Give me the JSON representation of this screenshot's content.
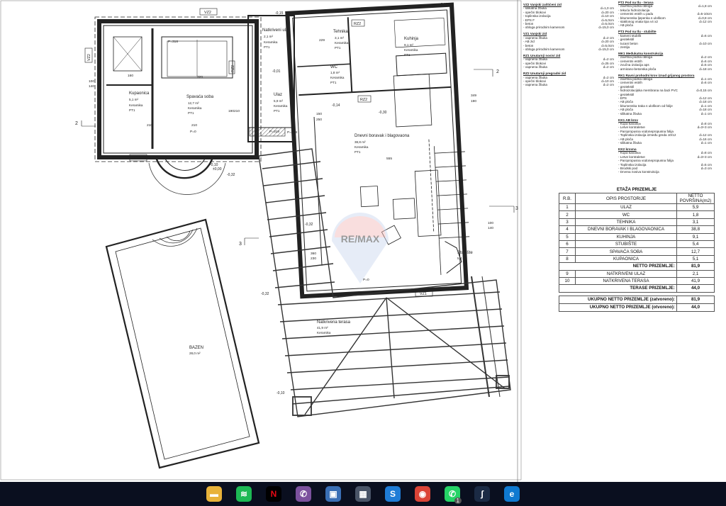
{
  "plan": {
    "rooms": [
      {
        "name": "Natkriveni ulaz",
        "area": "2,1 m²",
        "floor": "Keramika",
        "pt": "PT1"
      },
      {
        "name": "Tehnika",
        "area": "3,1 m²",
        "floor": "Keramika",
        "pt": "PT1"
      },
      {
        "name": "Kuhinja",
        "area": "9,1 m²",
        "floor": "Keramika",
        "pt": "PT1"
      },
      {
        "name": "WC",
        "area": "1,8 m²",
        "floor": "Keramika",
        "pt": "PT1"
      },
      {
        "name": "Spavaća soba",
        "area": "12,7 m²",
        "floor": "Keramika",
        "pt": "PT1"
      },
      {
        "name": "Kupaonica",
        "area": "5,1 m²",
        "floor": "Keramika",
        "pt": "PT1"
      },
      {
        "name": "Ulaz",
        "area": "5,9 m²",
        "floor": "Keramika",
        "pt": "PT1"
      },
      {
        "name": "Dnevni boravak i blagovaona",
        "area": "38,8 m²",
        "floor": "Keramika",
        "pt": "PT1"
      },
      {
        "name": "Stubište",
        "area": "5,4 m²",
        "floor": "",
        "pt": ""
      },
      {
        "name": "Natkrivena terasa",
        "area": "41,9 m²",
        "floor": "Keramika",
        "pt": ""
      },
      {
        "name": "BAZEN",
        "area": "28,0 m²",
        "floor": "",
        "pt": ""
      }
    ],
    "wall_tags": [
      "VZ2",
      "VZ2",
      "VZ2",
      "VZ1",
      "RZ2",
      "RZ2",
      "RZ2"
    ],
    "section_marks": [
      "2",
      "2",
      "3",
      "3"
    ],
    "levels": [
      "-0,15",
      "-0,01",
      "±0,00",
      "-0,30",
      "-0,14",
      "-0,32",
      "-0,10",
      "-0,10",
      "-0,32",
      "-0,32",
      "-0,15"
    ],
    "dimensions": [
      "320",
      "229",
      "160",
      "210",
      "210",
      "210",
      "150",
      "250",
      "555",
      "349",
      "190",
      "100",
      "140",
      "100",
      "140",
      "360",
      "230",
      "190",
      "P=318",
      "P=318",
      "P=318",
      "P=0",
      "P=0"
    ],
    "watermark": "RE/MAX"
  },
  "legend": [
    {
      "title": "VZ2 Vanjski zaštićeni zid",
      "items": [
        [
          "- silikatna žbuka",
          "d=1,0 cm"
        ],
        [
          "- opečni blokovi",
          "d=20 cm"
        ],
        [
          "- toplinska izolacija",
          "d=10 cm"
        ],
        [
          "- EPS F",
          "d=5,0cm"
        ],
        [
          "- beton",
          "d=5,0cm"
        ],
        [
          "- obloga prirodnim kamenom",
          "d=15,0 cm"
        ]
      ]
    },
    {
      "title": "VZ1 Vanjski zid",
      "items": [
        [
          "- vapnena žbuka",
          "d=2 cm"
        ],
        [
          "- AB zid",
          "d=20 cm"
        ],
        [
          "- beton",
          "d=5,0cm"
        ],
        [
          "- obloga prirodnim kamenom",
          "d=15,0 cm"
        ]
      ]
    },
    {
      "title": "RZ1 Unutarnji nosivi zid",
      "items": [
        [
          "- vapnena žbuka",
          "d=2 cm"
        ],
        [
          "- opečni blokovi",
          "d=25 cm"
        ],
        [
          "- vapnena žbuka",
          "d=2 cm"
        ]
      ]
    },
    {
      "title": "RZ2 Unutarnji pregradni zid",
      "items": [
        [
          "- vapnena žbuka",
          "d=2 cm"
        ],
        [
          "- opečni blokovi",
          "d=10 cm"
        ],
        [
          "- vapnena žbuka",
          "d=2 cm"
        ]
      ]
    }
  ],
  "legend2": [
    {
      "title": "PT2 Pod na tlu - terasa",
      "items": [
        [
          "- završna podna obloga",
          "d=1,8 cm"
        ],
        [
          "- tekuća hidroizolacija",
          ""
        ],
        [
          "- cementni estrih u padu",
          "d=5-10cm"
        ],
        [
          "- bitumenska ljepenka s uloškom",
          "d=0,8 cm"
        ],
        [
          "- staklonog vnata tipa v4 x2",
          "d=12 cm"
        ],
        [
          "- AB ploča",
          ""
        ]
      ]
    },
    {
      "title": "PT3 Pod na tlu - stubište",
      "items": [
        [
          "- kameni stubišt",
          "d=6 cm"
        ],
        [
          "- geotekstil",
          ""
        ],
        [
          "- tucani beton",
          "d=10 cm"
        ],
        [
          "- zemlja",
          ""
        ]
      ]
    },
    {
      "title": "MK1 Međukatna konstrukcija",
      "items": [
        [
          "- završna podna obloga",
          "d=2 cm"
        ],
        [
          "- cementni estrih",
          "d=6 cm"
        ],
        [
          "- zvučna izolacija aps",
          "d=5 cm"
        ],
        [
          "- armirano-betonska ploča",
          "d=18 cm"
        ]
      ]
    },
    {
      "title": "RK1 Ravni prohodni krov iznad grijanog prostora",
      "items": [
        [
          "- završna podna obloga",
          "d=1 cm"
        ],
        [
          "- cementni estrih",
          "d=6 cm"
        ],
        [
          "- geotekstil",
          ""
        ],
        [
          "- hidroizolacijska membrana na bazi PVC",
          "d=0,15 cm"
        ],
        [
          "- geotekstil",
          ""
        ],
        [
          "- EPS",
          "d=12 cm"
        ],
        [
          "- AB ploča",
          "d=18 cm"
        ],
        [
          "- bitumenska traka s uloškom od folije",
          "d=1 cm"
        ],
        [
          "- AB ploča",
          "d=18 cm"
        ],
        [
          "- silikatna žbuka",
          "d=1 cm"
        ]
      ]
    },
    {
      "title": "KK1 AB krov",
      "items": [
        [
          "- Kupa kanalica",
          "d=8 cm"
        ],
        [
          "- Letve kontraletve",
          "d=3+3 cm"
        ],
        [
          "- Paropropusna vodonepropusna folija",
          ""
        ],
        [
          "- Toplinska izolacija između greda 10/12",
          "d=12 cm"
        ],
        [
          "- AB ploča",
          "d=16 cm"
        ],
        [
          "- silikatna žbuka",
          "d=1 cm"
        ]
      ]
    },
    {
      "title": "KK2 krovna",
      "items": [
        [
          "- Kupa kanalica",
          "d=8 cm"
        ],
        [
          "- Letve kontraletve",
          "d=3+3 cm"
        ],
        [
          "- Paropropusna vodonepropusna folija",
          ""
        ],
        [
          "- Toplinska izolacija",
          "d=5 cm"
        ],
        [
          "- Brodski pod",
          "d=3 cm"
        ],
        [
          "- Drvena nosiva konstrukcija",
          ""
        ]
      ]
    }
  ],
  "table": {
    "title": "ETAŽA PRIZEMLJE",
    "headers": {
      "rb": "R.B.",
      "desc": "OPIS PROSTORIJE",
      "area": "NETTO POVRŠINA(m2)"
    },
    "rows": [
      {
        "rb": "1",
        "desc": "ULAZ",
        "area": "5,9"
      },
      {
        "rb": "2",
        "desc": "WC",
        "area": "1,8"
      },
      {
        "rb": "3",
        "desc": "TEHNIKA",
        "area": "3,1"
      },
      {
        "rb": "4",
        "desc": "DNEVNI BORAVAK I BLAGOVAONICA",
        "area": "38,8"
      },
      {
        "rb": "5",
        "desc": "KUHINJA",
        "area": "9,1"
      },
      {
        "rb": "6",
        "desc": "STUBIŠTE",
        "area": "5,4"
      },
      {
        "rb": "7",
        "desc": "SPAVAĆA SOBA",
        "area": "12,7"
      },
      {
        "rb": "8",
        "desc": "KUPAONICA",
        "area": "5,1"
      }
    ],
    "net_label": "NETTO PRIZEMLJE:",
    "net_value": "81,9",
    "rows2": [
      {
        "rb": "9",
        "desc": "NATKRIVENI ULAZ",
        "area": "2,1"
      },
      {
        "rb": "10",
        "desc": "NATKRIVENA TERASA",
        "area": "41,9"
      }
    ],
    "terrace_label": "TERASE PRIZEMLJE:",
    "terrace_value": "44,0",
    "total_closed_label": "UKUPNO NETTO PRIZEMLJE (zatvoreno):",
    "total_closed_value": "81,9",
    "total_open_label": "UKUPNO NETTO PRIZEMLJE (otvoreno):",
    "total_open_value": "44,0"
  },
  "taskbar": {
    "apps": [
      {
        "name": "file-explorer-icon",
        "glyph": "▬",
        "color": "#e8b23a"
      },
      {
        "name": "spotify-icon",
        "glyph": "≋",
        "color": "#1db954"
      },
      {
        "name": "netflix-icon",
        "glyph": "N",
        "color": "#000000"
      },
      {
        "name": "viber-icon",
        "glyph": "✆",
        "color": "#7b519d"
      },
      {
        "name": "remote-desktop-icon",
        "glyph": "▣",
        "color": "#3a6fb5"
      },
      {
        "name": "calculator-icon",
        "glyph": "▦",
        "color": "#4a5568"
      },
      {
        "name": "skype-icon",
        "glyph": "S",
        "color": "#1f7cd6"
      },
      {
        "name": "chrome-icon",
        "glyph": "◉",
        "color": "#db4437"
      },
      {
        "name": "whatsapp-icon",
        "glyph": "✆",
        "color": "#25d366"
      },
      {
        "name": "fusion-icon",
        "glyph": "ʃ",
        "color": "#1b2a44"
      },
      {
        "name": "edge-icon",
        "glyph": "e",
        "color": "#0f79d0"
      }
    ],
    "whatsapp_badge": "1"
  }
}
